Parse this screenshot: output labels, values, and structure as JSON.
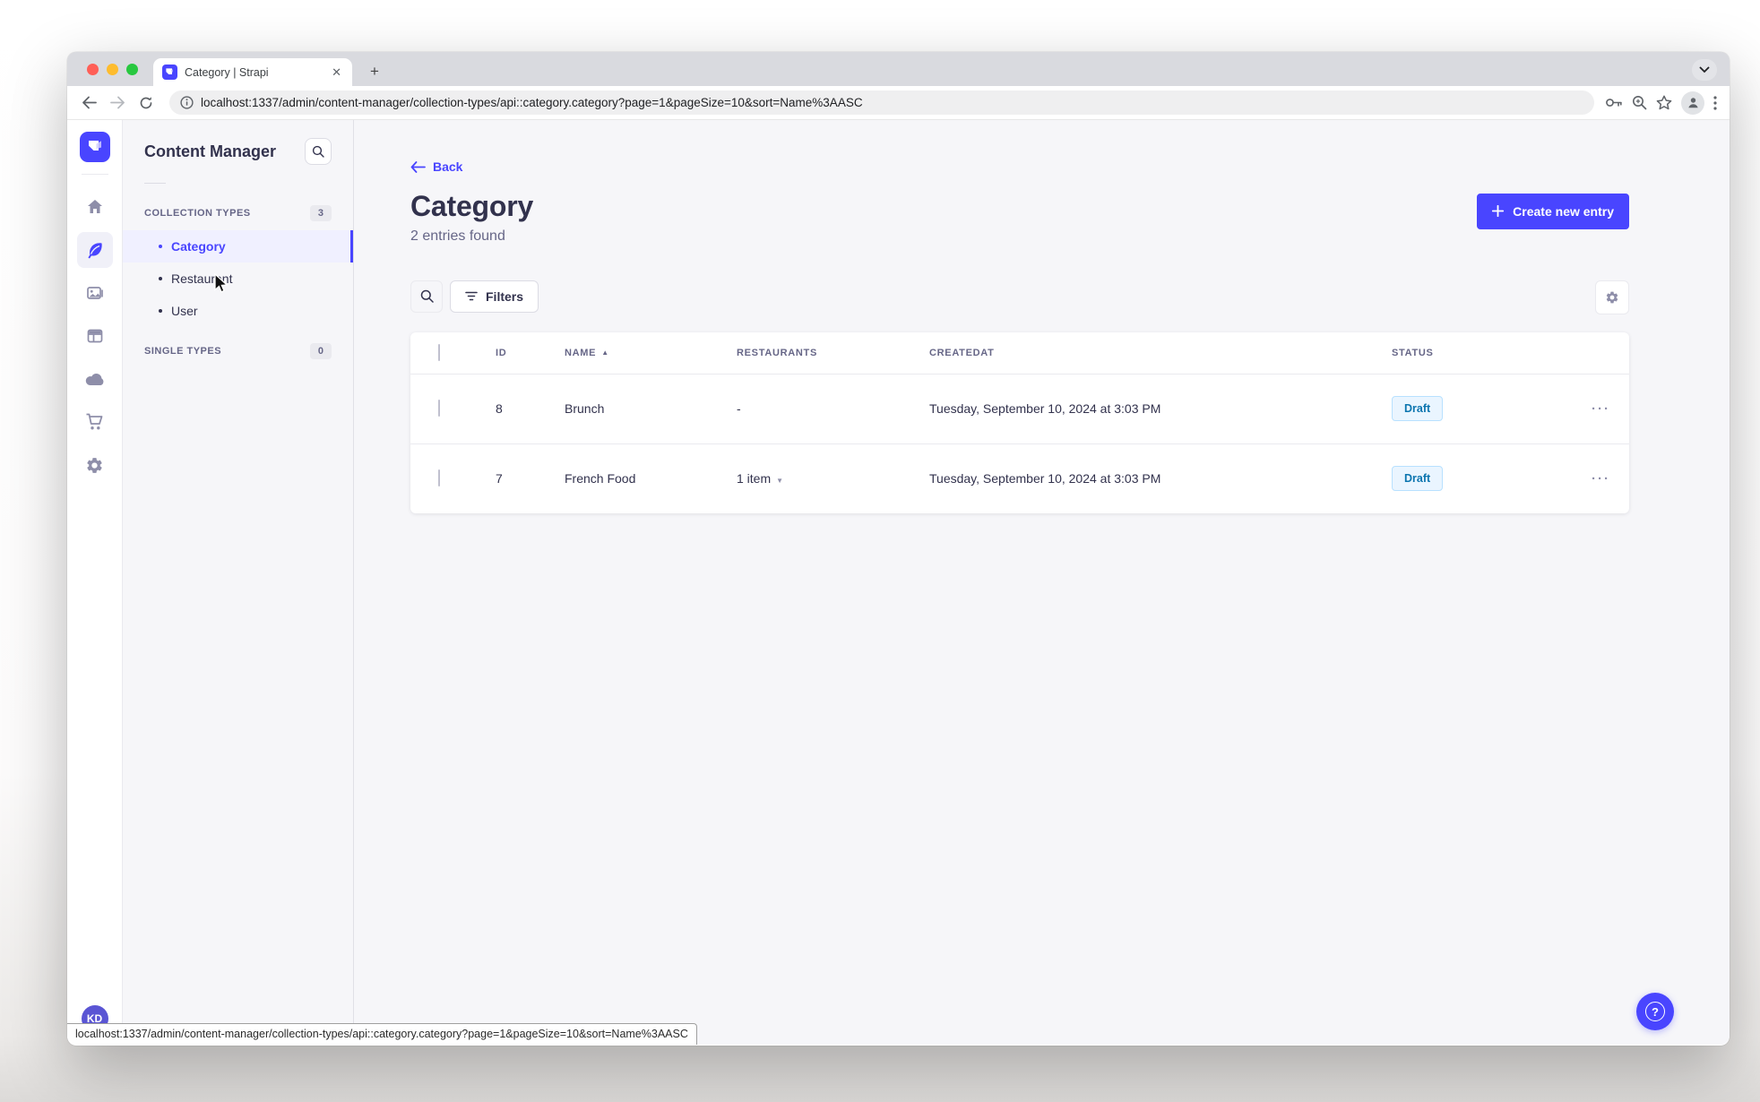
{
  "colors": {
    "accent": "#4945ff",
    "active_item_bg": "#f0f0ff",
    "draft_bg": "#eaf5ff",
    "draft_border": "#b8e1ff",
    "draft_text": "#0c75af",
    "text_dark": "#32324d",
    "text_muted": "#666687"
  },
  "browser": {
    "tab_title": "Category | Strapi",
    "url": "localhost:1337/admin/content-manager/collection-types/api::category.category?page=1&pageSize=10&sort=Name%3AASC",
    "status_url": "localhost:1337/admin/content-manager/collection-types/api::category.category?page=1&pageSize=10&sort=Name%3AASC",
    "new_tab_label": "+",
    "close_tab_label": "✕"
  },
  "rail": {
    "icons": [
      "strapi-logo",
      "home",
      "content-manager",
      "media-library",
      "content-type-builder",
      "deploy-cloud",
      "marketplace-cart",
      "settings-gear"
    ],
    "active_icon": "content-manager"
  },
  "subnav": {
    "title": "Content Manager",
    "collection_types_label": "COLLECTION TYPES",
    "collection_types_count": "3",
    "items": [
      {
        "label": "Category",
        "active": true
      },
      {
        "label": "Restaurant",
        "active": false
      },
      {
        "label": "User",
        "active": false
      }
    ],
    "single_types_label": "SINGLE TYPES",
    "single_types_count": "0"
  },
  "header": {
    "back_label": "Back",
    "title": "Category",
    "subtitle": "2 entries found",
    "create_button_label": "Create new entry"
  },
  "filters": {
    "filters_label": "Filters"
  },
  "table": {
    "columns": [
      "ID",
      "NAME",
      "RESTAURANTS",
      "CREATEDAT",
      "STATUS"
    ],
    "sorted_column": "NAME",
    "rows": [
      {
        "id": "8",
        "name": "Brunch",
        "restaurants": "-",
        "created_at": "Tuesday, September 10, 2024 at 3:03 PM",
        "status": "Draft",
        "actions": "···"
      },
      {
        "id": "7",
        "name": "French Food",
        "restaurants": "1 item",
        "created_at": "Tuesday, September 10, 2024 at 3:03 PM",
        "status": "Draft",
        "actions": "···"
      }
    ]
  },
  "user": {
    "initials": "KD"
  }
}
